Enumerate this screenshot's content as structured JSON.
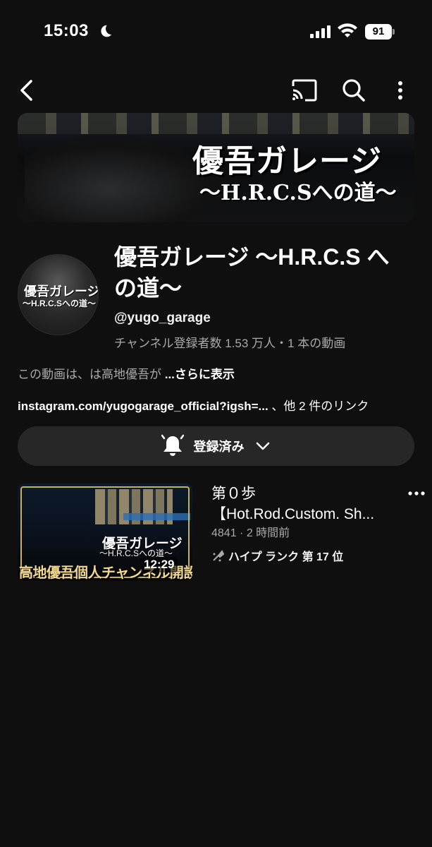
{
  "status_bar": {
    "time": "15:03",
    "battery": "91",
    "icons": [
      "moon-icon",
      "signal-icon",
      "wifi-icon",
      "battery-icon"
    ]
  },
  "nav": {
    "icons": [
      "back-icon",
      "cast-icon",
      "search-icon",
      "more-vert-icon"
    ]
  },
  "banner": {
    "title": "優吾ガレージ",
    "subtitle": "〜H.R.C.Sへの道〜"
  },
  "channel": {
    "avatar_text_1": "優吾ガレージ",
    "avatar_text_2": "〜H.R.C.Sへの道〜",
    "name": "優吾ガレージ 〜H.R.C.S への道〜",
    "handle": "@yugo_garage",
    "meta": "チャンネル登録者数 1.53 万人・1 本の動画",
    "description": "この動画は、は高地優吾が",
    "description_more": "...さらに表示",
    "link": "instagram.com/yugogarage_official?igsh=...",
    "link_more": "、他 2 件のリンク"
  },
  "subscribe": {
    "label": "登録済み",
    "icons": [
      "bell-icon",
      "chevron-down-icon"
    ]
  },
  "video": {
    "title_line1": "第０歩",
    "title_line2": "【Hot.Rod.Custom. Sh...",
    "meta": "4841 · 2 時間前",
    "hype": "ハイプ ランク 第 17 位",
    "duration": "12:29",
    "thumb_title": "優吾ガレージ",
    "thumb_sub": "〜H.R.C.Sへの道〜",
    "thumb_banner": "高地優吾個人チャンネル開設"
  },
  "colors": {
    "background": "#0f0f0f",
    "button_bg": "#272727",
    "secondary_text": "#aaaaaa"
  }
}
